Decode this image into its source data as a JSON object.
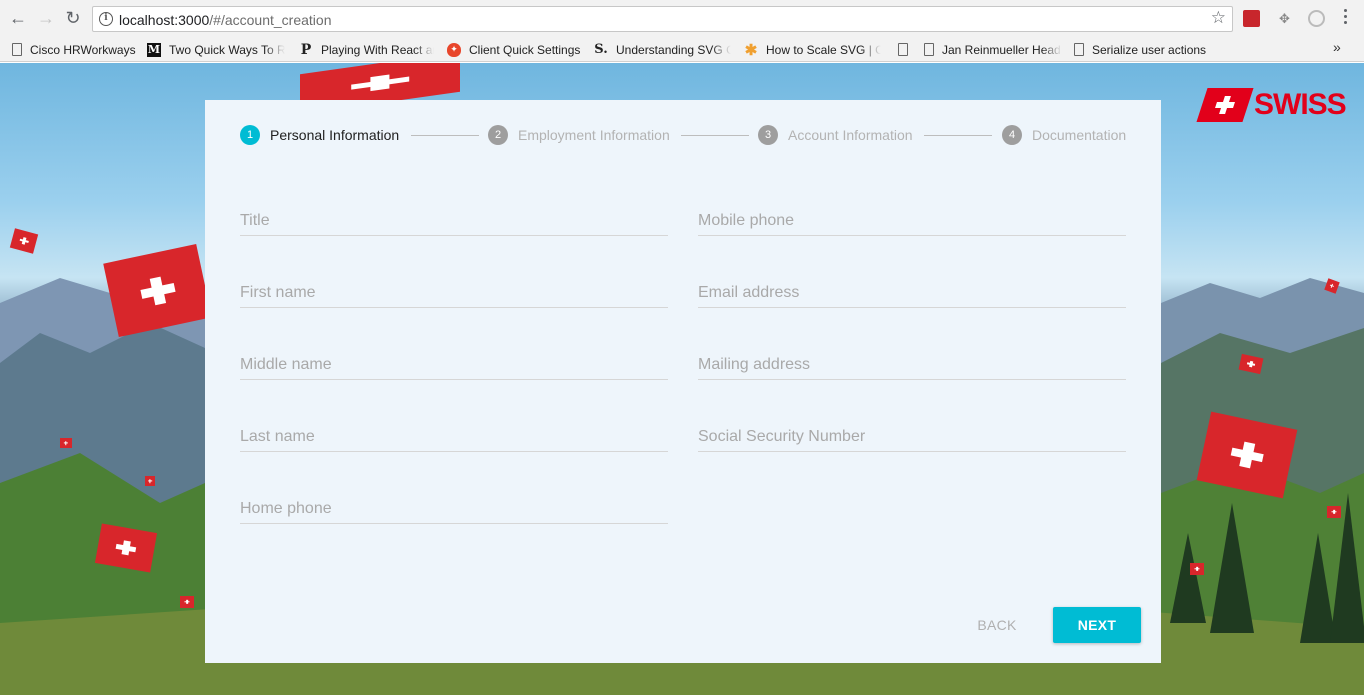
{
  "browser": {
    "url_host": "localhost:3000",
    "url_path": "/#/account_creation",
    "bookmarks": [
      {
        "label": "Cisco HRWorkways",
        "icon": "page-icon"
      },
      {
        "label": "Two Quick Ways To R",
        "icon": "medium-icon"
      },
      {
        "label": "Playing With React ar",
        "icon": "p-icon"
      },
      {
        "label": "Client Quick Settings",
        "icon": "shield-icon"
      },
      {
        "label": "Understanding SVG C",
        "icon": "s-icon"
      },
      {
        "label": "How to Scale SVG | C",
        "icon": "asterisk-icon"
      },
      {
        "label": "",
        "icon": "page-icon"
      },
      {
        "label": "Jan Reinmueller Head",
        "icon": "page-icon"
      },
      {
        "label": "Serialize user actions",
        "icon": "page-icon"
      }
    ],
    "overflow_chevron": "»"
  },
  "logo": {
    "text": "SWISS",
    "brand_color": "#e2001a"
  },
  "stepper": {
    "steps": [
      {
        "number": "1",
        "label": "Personal Information",
        "active": true
      },
      {
        "number": "2",
        "label": "Employment Information",
        "active": false
      },
      {
        "number": "3",
        "label": "Account Information",
        "active": false
      },
      {
        "number": "4",
        "label": "Documentation",
        "active": false
      }
    ],
    "active_color": "#00bcd4"
  },
  "form": {
    "left": [
      {
        "placeholder": "Title",
        "value": ""
      },
      {
        "placeholder": "First name",
        "value": ""
      },
      {
        "placeholder": "Middle name",
        "value": ""
      },
      {
        "placeholder": "Last name",
        "value": ""
      },
      {
        "placeholder": "Home phone",
        "value": ""
      }
    ],
    "right": [
      {
        "placeholder": "Mobile phone",
        "value": ""
      },
      {
        "placeholder": "Email address",
        "value": ""
      },
      {
        "placeholder": "Mailing address",
        "value": ""
      },
      {
        "placeholder": "Social Security Number",
        "value": ""
      }
    ]
  },
  "actions": {
    "back_label": "BACK",
    "next_label": "NEXT"
  }
}
